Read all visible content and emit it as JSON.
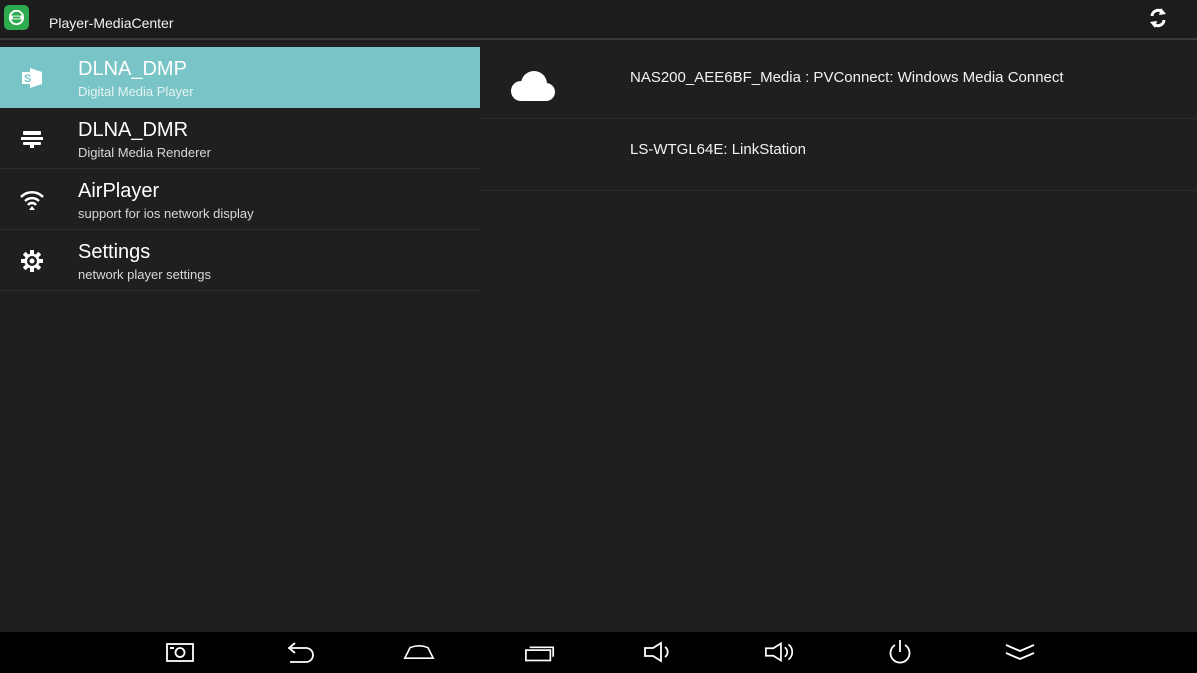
{
  "app": {
    "title": "Player-MediaCenter",
    "icon": "app-logo-icon",
    "sync_icon": "sync-icon"
  },
  "sidebar": {
    "items": [
      {
        "title": "DLNA_DMP",
        "subtitle": "Digital Media Player",
        "icon": "dlna-dmp-icon",
        "active": true
      },
      {
        "title": "DLNA_DMR",
        "subtitle": "Digital Media Renderer",
        "icon": "dlna-dmr-icon",
        "active": false
      },
      {
        "title": "AirPlayer",
        "subtitle": "support for ios network display",
        "icon": "wifi-icon",
        "active": false
      },
      {
        "title": "Settings",
        "subtitle": "network player settings",
        "icon": "gear-icon",
        "active": false
      }
    ]
  },
  "devices": [
    {
      "name": "NAS200_AEE6BF_Media : PVConnect: Windows Media Connect",
      "icon": "cloud-icon"
    },
    {
      "name": "LS-WTGL64E: LinkStation",
      "icon": ""
    }
  ],
  "navbar": {
    "buttons": [
      "screenshot-icon",
      "back-icon",
      "home-icon",
      "recents-icon",
      "volume-down-icon",
      "volume-up-icon",
      "power-icon",
      "collapse-icon"
    ]
  },
  "colors": {
    "background": "#1f1f1f",
    "accent": "#79c4c6",
    "app_icon": "#2eaa4f",
    "navbar": "#000000"
  }
}
